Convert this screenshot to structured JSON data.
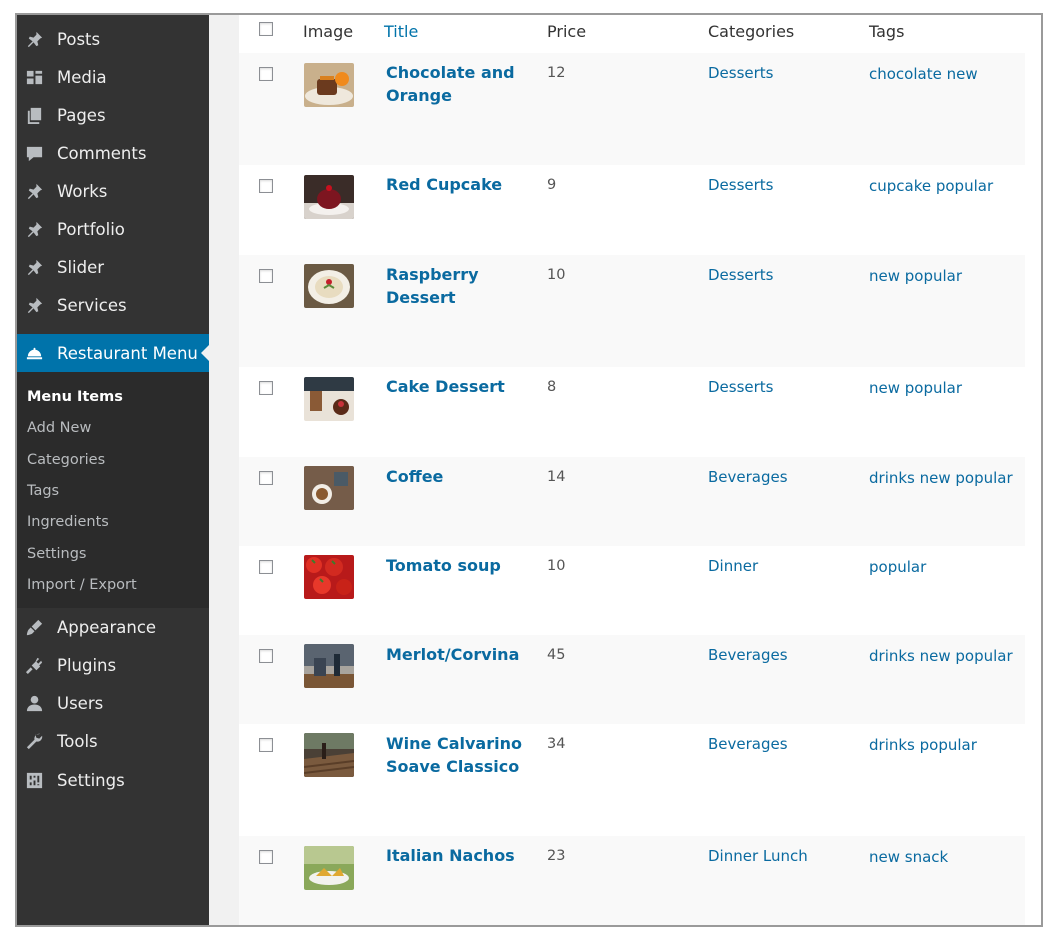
{
  "sidebar": {
    "items": [
      {
        "label": "Posts",
        "icon": "pushpin-icon"
      },
      {
        "label": "Media",
        "icon": "media-icon"
      },
      {
        "label": "Pages",
        "icon": "pages-icon"
      },
      {
        "label": "Comments",
        "icon": "comment-icon"
      },
      {
        "label": "Works",
        "icon": "pushpin-icon"
      },
      {
        "label": "Portfolio",
        "icon": "pushpin-icon"
      },
      {
        "label": "Slider",
        "icon": "pushpin-icon"
      },
      {
        "label": "Services",
        "icon": "pushpin-icon"
      }
    ],
    "active": {
      "label": "Restaurant Menu",
      "icon": "restaurant-icon"
    },
    "submenu": [
      {
        "label": "Menu Items"
      },
      {
        "label": "Add New"
      },
      {
        "label": "Categories"
      },
      {
        "label": "Tags"
      },
      {
        "label": "Ingredients"
      },
      {
        "label": "Settings"
      },
      {
        "label": "Import / Export"
      }
    ],
    "lower_items": [
      {
        "label": "Appearance",
        "icon": "paintbrush-icon"
      },
      {
        "label": "Plugins",
        "icon": "plugin-icon"
      },
      {
        "label": "Users",
        "icon": "user-icon"
      },
      {
        "label": "Tools",
        "icon": "wrench-icon"
      },
      {
        "label": "Settings",
        "icon": "settings-icon"
      }
    ],
    "accent_color": "#0073aa"
  },
  "table": {
    "columns": [
      "Image",
      "Title",
      "Price",
      "Categories",
      "Tags"
    ],
    "rows": [
      {
        "title": "Chocolate and Orange",
        "price": "12",
        "categories": "Desserts",
        "tags": "chocolate new",
        "thumb": "chocolate-orange-photo"
      },
      {
        "title": "Red Cupcake",
        "price": "9",
        "categories": "Desserts",
        "tags": "cupcake popular",
        "thumb": "red-cupcake-photo"
      },
      {
        "title": "Raspberry Dessert",
        "price": "10",
        "categories": "Desserts",
        "tags": "new popular",
        "thumb": "raspberry-dessert-photo"
      },
      {
        "title": "Cake Dessert",
        "price": "8",
        "categories": "Desserts",
        "tags": "new popular",
        "thumb": "cake-dessert-photo"
      },
      {
        "title": "Coffee",
        "price": "14",
        "categories": "Beverages",
        "tags": "drinks new popular",
        "thumb": "coffee-photo"
      },
      {
        "title": "Tomato soup",
        "price": "10",
        "categories": "Dinner",
        "tags": "popular",
        "thumb": "tomato-soup-photo"
      },
      {
        "title": "Merlot/Corvina",
        "price": "45",
        "categories": "Beverages",
        "tags": "drinks new popular",
        "thumb": "merlot-photo"
      },
      {
        "title": "Wine Calvarino Soave Classico",
        "price": "34",
        "categories": "Beverages",
        "tags": "drinks popular",
        "thumb": "wine-photo"
      },
      {
        "title": "Italian Nachos",
        "price": "23",
        "categories": "Dinner Lunch",
        "tags": "new snack",
        "thumb": "nachos-photo"
      }
    ]
  }
}
